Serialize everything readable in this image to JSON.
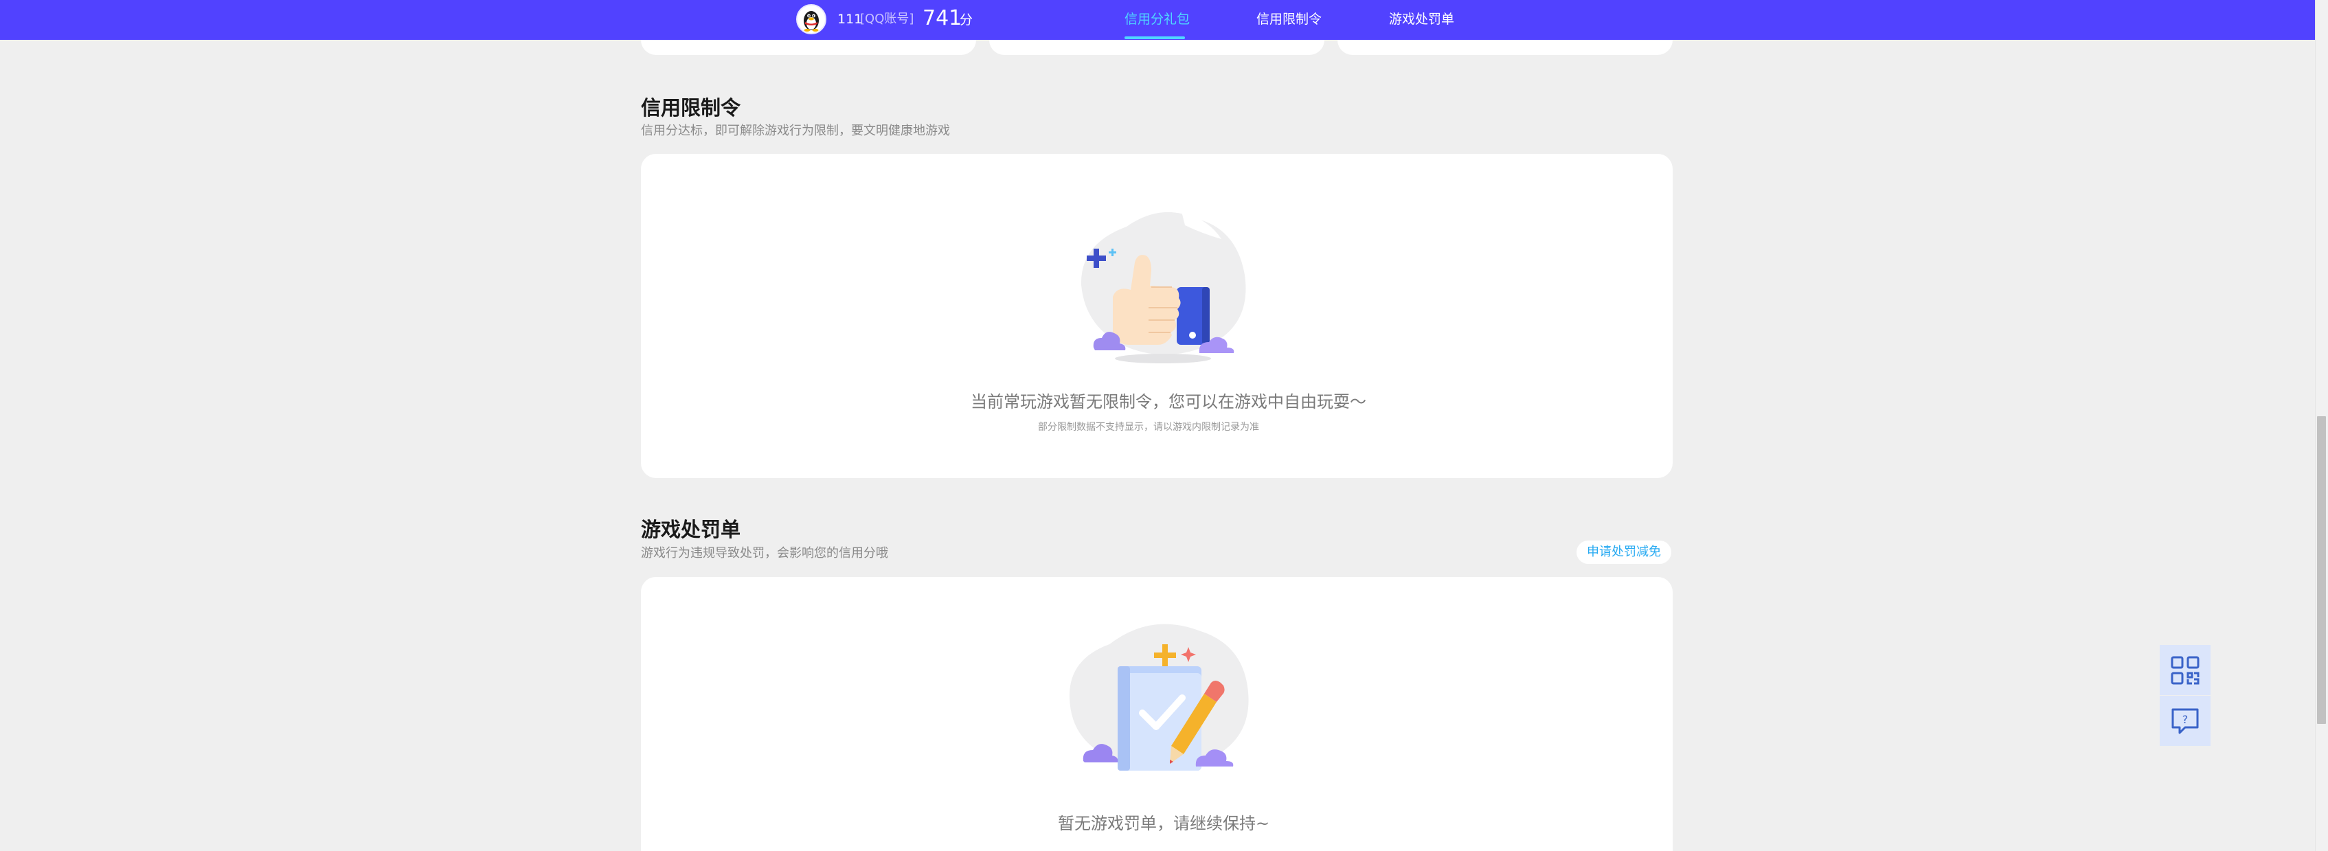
{
  "header": {
    "user_id": "111",
    "account_type": "[QQ账号]",
    "score": "741",
    "score_unit": "分",
    "tabs": [
      {
        "label": "信用分礼包",
        "active": true
      },
      {
        "label": "信用限制令",
        "active": false
      },
      {
        "label": "游戏处罚单",
        "active": false
      }
    ],
    "bar_color": "#5142ff",
    "active_tab_color": "#4fd6ff"
  },
  "restriction": {
    "title": "信用限制令",
    "subtitle": "信用分达标，即可解除游戏行为限制，要文明健康地游戏",
    "empty_message": "当前常玩游戏暂无限制令，您可以在游戏中自由玩耍～",
    "empty_note": "部分限制数据不支持显示，请以游戏内限制记录为准",
    "illustration_icon": "thumbs-up-icon"
  },
  "penalty": {
    "title": "游戏处罚单",
    "subtitle": "游戏行为违规导致处罚，会影响您的信用分哦",
    "appeal_button": "申请处罚减免",
    "empty_message": "暂无游戏罚单，请继续保持~",
    "illustration_icon": "clipboard-check-icon"
  },
  "float_tools": [
    {
      "icon": "qr-code-icon"
    },
    {
      "icon": "help-chat-icon"
    }
  ]
}
